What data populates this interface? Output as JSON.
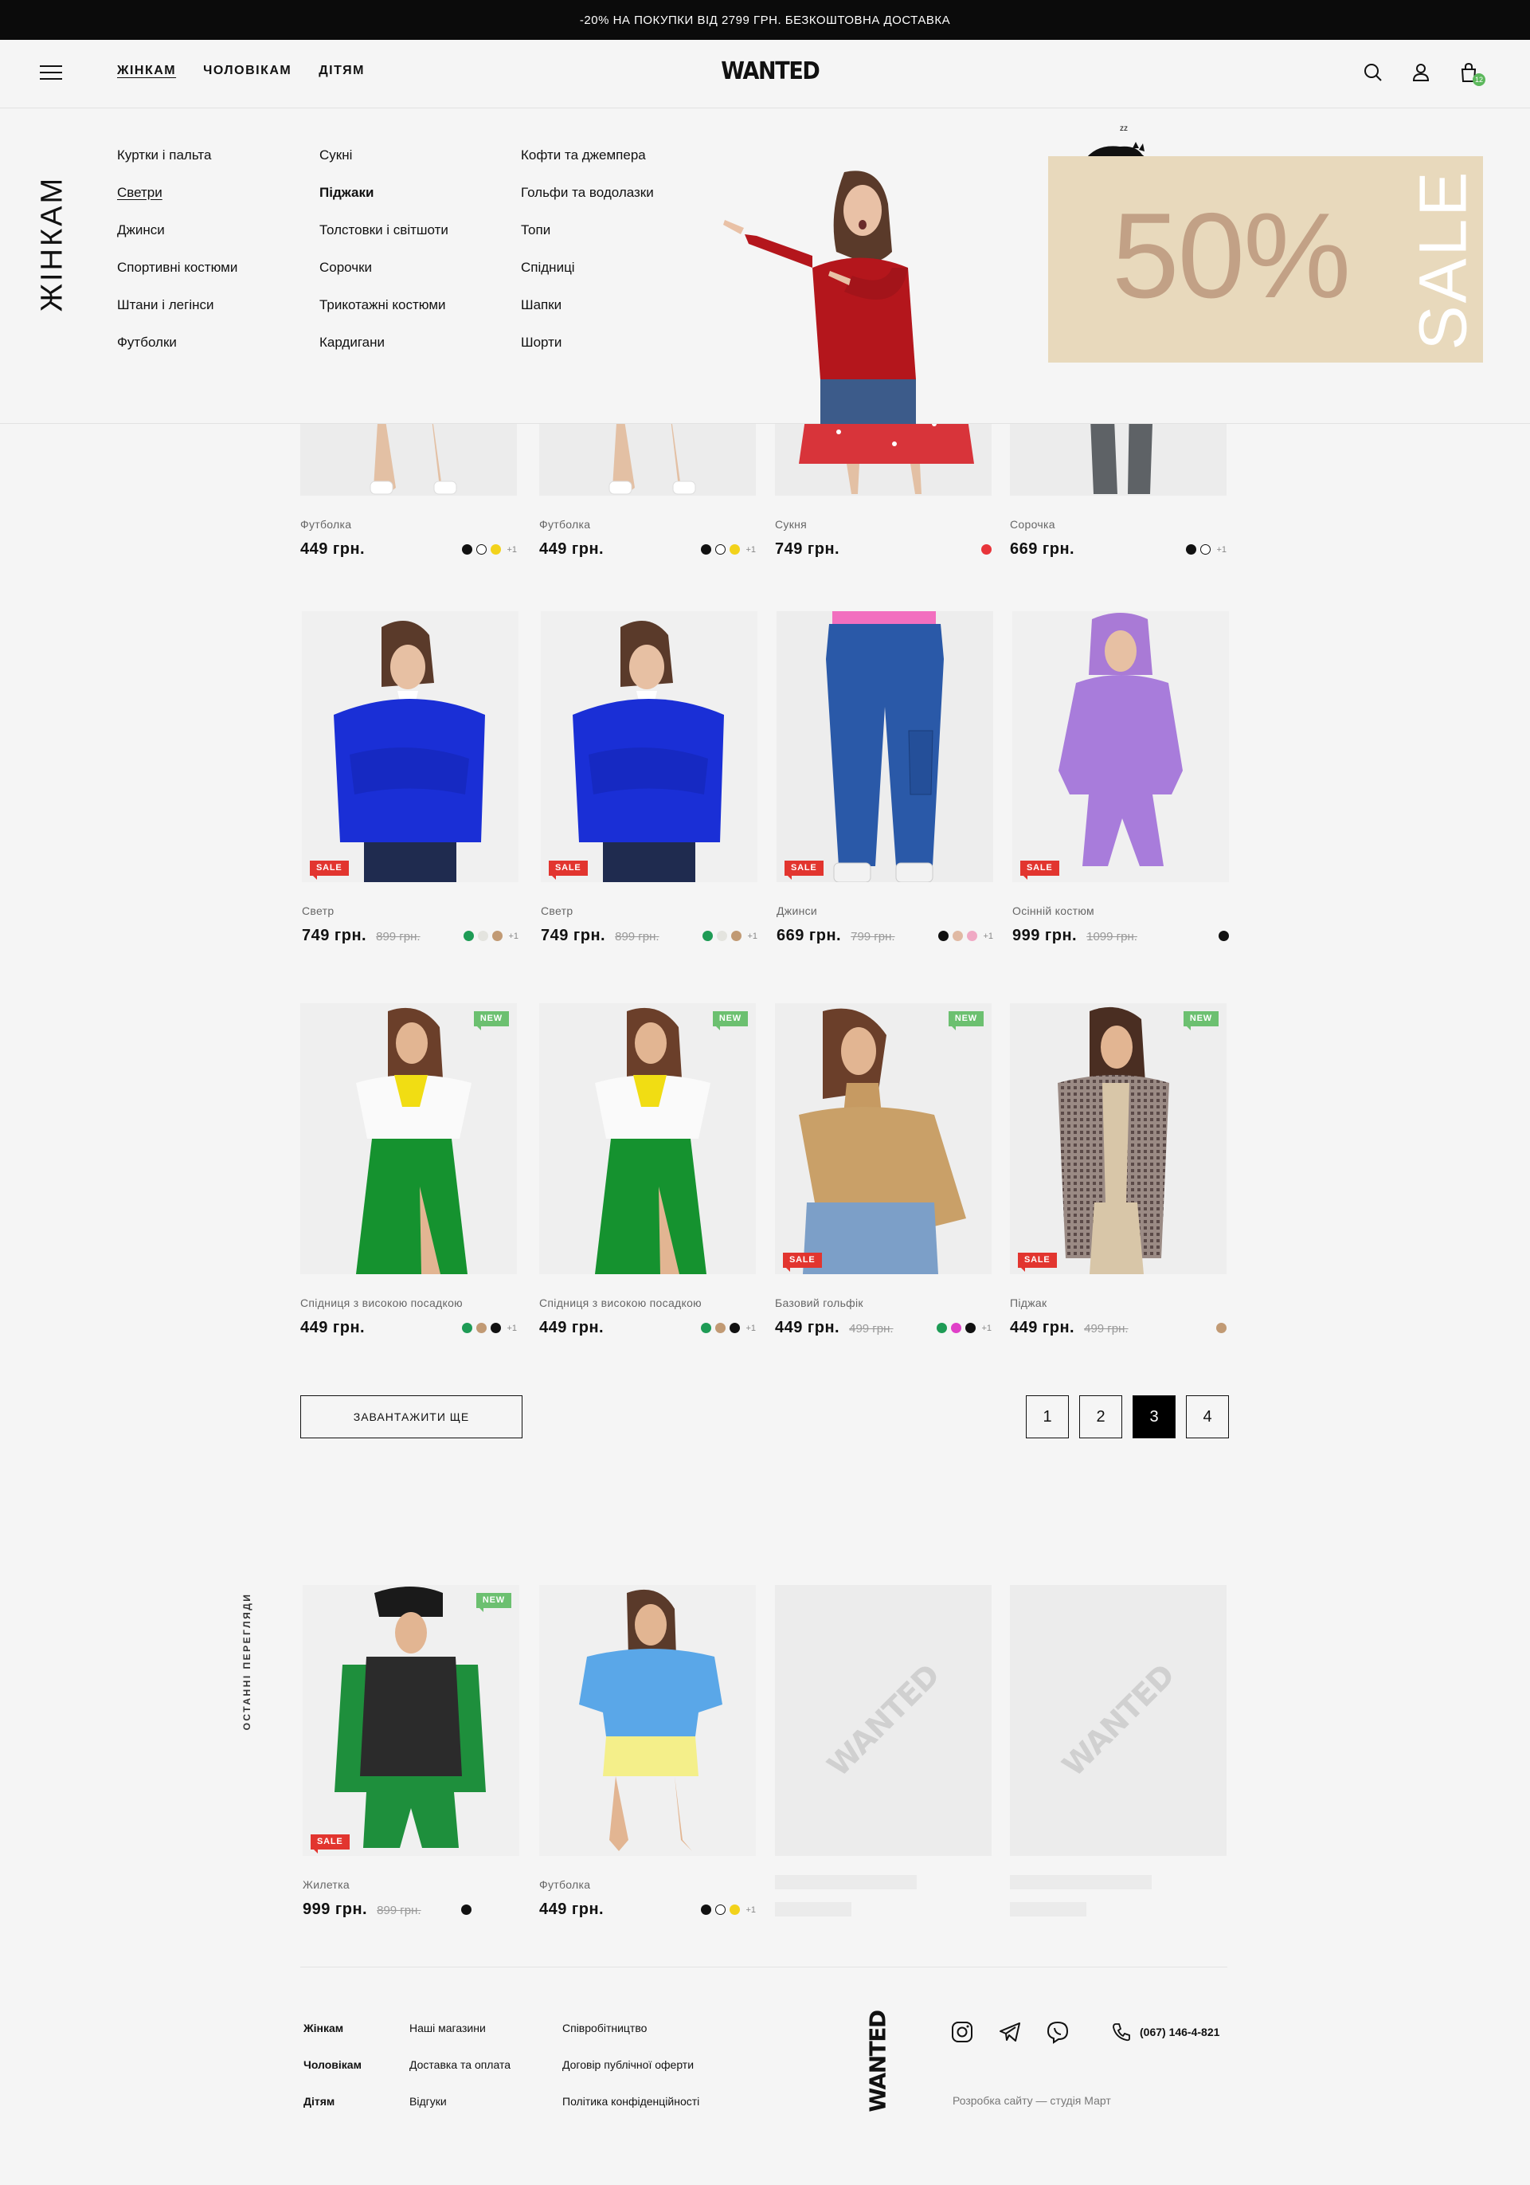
{
  "topbar": {
    "text": "-20% НА ПОКУПКИ ВІД 2799 ГРН. БЕЗКОШТОВНА ДОСТАВКА"
  },
  "header": {
    "nav": [
      "ЖІНКАМ",
      "ЧОЛОВІКАМ",
      "ДІТЯМ"
    ],
    "logo": "WANTED",
    "cart_count": "12"
  },
  "mega": {
    "title": "ЖІНКАМ",
    "col1": [
      "Куртки і пальта",
      "Светри",
      "Джинси",
      "Спортивні костюми",
      "Штани і легінси",
      "Футболки"
    ],
    "col2": [
      "Сукні",
      "Піджаки",
      "Толстовки і світшоти",
      "Сорочки",
      "Трикотажні костюми",
      "Кардигани"
    ],
    "col3": [
      "Кофти та джемпера",
      "Гольфи та водолазки",
      "Топи",
      "Спідниці",
      "Шапки",
      "Шорти"
    ],
    "sale_percent": "50%",
    "sale_word": "SALE",
    "sleep_text": "zz"
  },
  "products_row1": [
    {
      "category": "Футболка",
      "price": "449 грн.",
      "swatches": [
        "#111111",
        "outline",
        "#f2d21b"
      ],
      "more": "+1"
    },
    {
      "category": "Футболка",
      "price": "449 грн.",
      "swatches": [
        "#111111",
        "outline",
        "#f2d21b"
      ],
      "more": "+1"
    },
    {
      "category": "Сукня",
      "price": "749 грн.",
      "swatches": [
        "#e8343a"
      ],
      "more": ""
    },
    {
      "category": "Сорочка",
      "price": "669 грн.",
      "swatches": [
        "#111111",
        "outline"
      ],
      "more": "+1"
    }
  ],
  "products_row2": [
    {
      "category": "Светр",
      "price": "749 грн.",
      "old": "899 грн.",
      "badge": "SALE",
      "swatches": [
        "#1e9b55",
        "#e4e4df",
        "#c19a74"
      ],
      "more": "+1"
    },
    {
      "category": "Светр",
      "price": "749 грн.",
      "old": "899 грн.",
      "badge": "SALE",
      "swatches": [
        "#1e9b55",
        "#e4e4df",
        "#c19a74"
      ],
      "more": "+1"
    },
    {
      "category": "Джинси",
      "price": "669 грн.",
      "old": "799 грн.",
      "badge": "SALE",
      "swatches": [
        "#111111",
        "#e0b9a3",
        "#f0a9c4"
      ],
      "more": "+1"
    },
    {
      "category": "Осінній костюм",
      "price": "999 грн.",
      "old": "1099 грн.",
      "badge": "SALE",
      "swatches": [
        "#111111"
      ],
      "more": ""
    }
  ],
  "products_row3": [
    {
      "category": "Спідниця з високою посадкою",
      "price": "449 грн.",
      "old": "",
      "badge": "NEW",
      "swatches": [
        "#1e9b55",
        "#c19a74",
        "#111111"
      ],
      "more": "+1"
    },
    {
      "category": "Спідниця з високою посадкою",
      "price": "449 грн.",
      "old": "",
      "badge": "NEW",
      "swatches": [
        "#1e9b55",
        "#c19a74",
        "#111111"
      ],
      "more": "+1"
    },
    {
      "category": "Базовий гольфік",
      "price": "449 грн.",
      "old": "499 грн.",
      "badge": "NEW",
      "badge2": "SALE",
      "swatches": [
        "#1e9b55",
        "#e040c8",
        "#111111"
      ],
      "more": "+1"
    },
    {
      "category": "Піджак",
      "price": "449 грн.",
      "old": "499 грн.",
      "badge": "NEW",
      "badge2": "SALE",
      "swatches": [
        "#c19a74"
      ],
      "more": ""
    }
  ],
  "load_more": "ЗАВАНТАЖИТИ ЩЕ",
  "pages": [
    "1",
    "2",
    "3",
    "4"
  ],
  "recent": {
    "title": "ОСТАННІ ПЕРЕГЛЯДИ",
    "items": [
      {
        "category": "Жилетка",
        "price": "999 грн.",
        "old": "899 грн.",
        "badge": "NEW",
        "badge2": "SALE",
        "swatches": [
          "#111111"
        ],
        "more": ""
      },
      {
        "category": "Футболка",
        "price": "449 грн.",
        "old": "",
        "swatches": [
          "#111111",
          "outline",
          "#f2d21b"
        ],
        "more": "+1"
      }
    ],
    "placeholder_logo": "WANTED"
  },
  "footer": {
    "col1": [
      "Жінкам",
      "Чоловікам",
      "Дітям"
    ],
    "col2": [
      "Наші магазини",
      "Доставка та оплата",
      "Відгуки"
    ],
    "col3": [
      "Співробітництво",
      "Договір публічної оферти",
      "Політика конфіденційності"
    ],
    "logo": "WANTED",
    "phone": "(067) 146-4-821",
    "credit": "Розробка сайту — студія Март"
  }
}
